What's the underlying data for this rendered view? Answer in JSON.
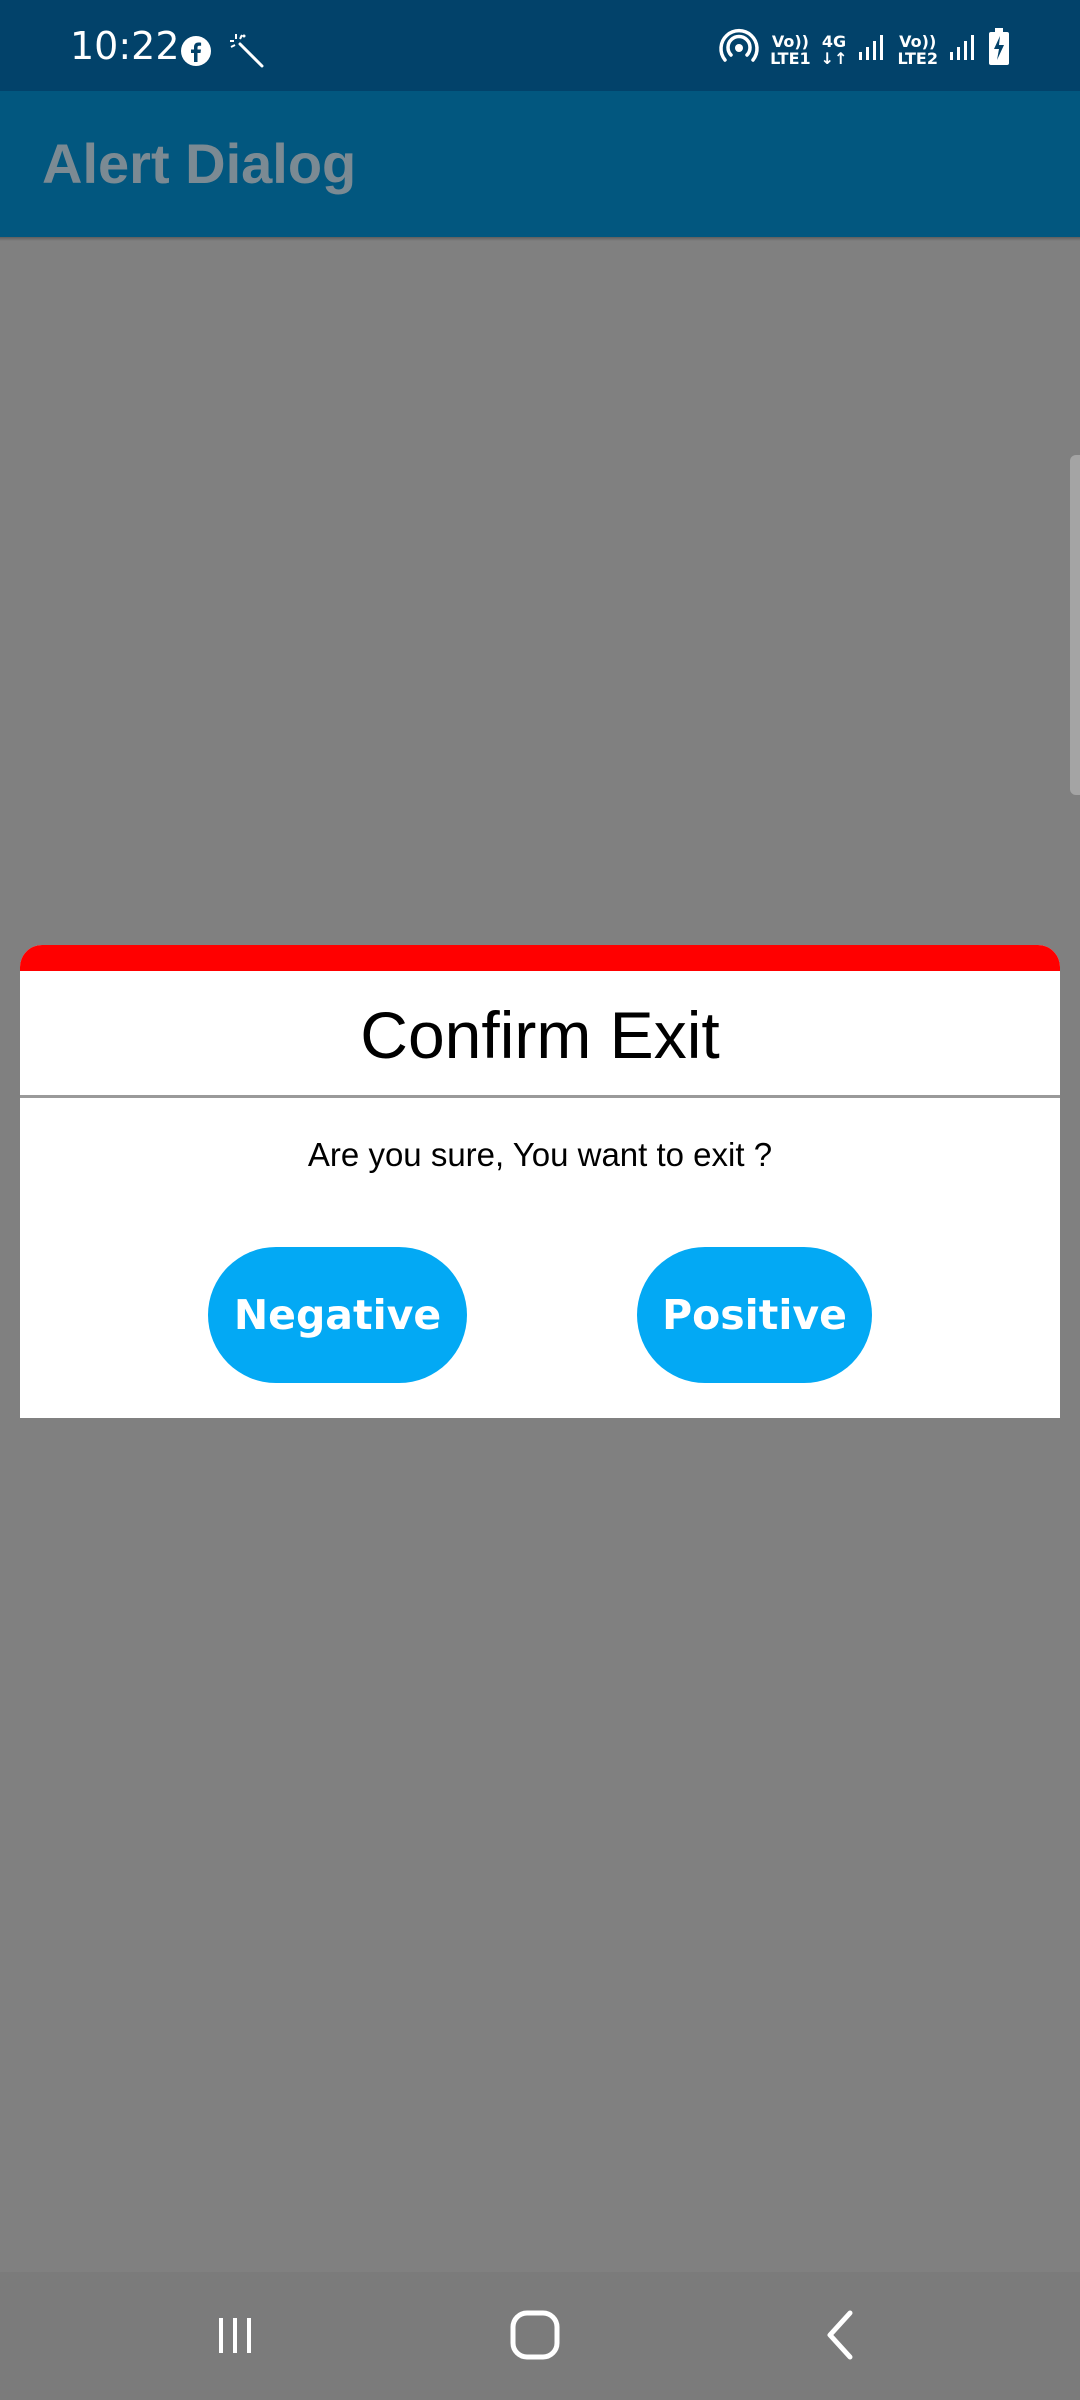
{
  "status_bar": {
    "time": "10:22",
    "left_icons": [
      "facebook-icon",
      "magic-wand-icon"
    ],
    "right_icons": [
      "hotspot-icon",
      "volte1-icon",
      "4g-data-icon",
      "signal1-icon",
      "volte2-icon",
      "signal2-icon",
      "battery-charging-icon"
    ],
    "volte1_top": "Vo))",
    "volte1_bottom": "LTE1",
    "net_type": "4G",
    "volte2_top": "Vo))",
    "volte2_bottom": "LTE2",
    "colors": {
      "background": "#02426a",
      "foreground": "#ffffff"
    }
  },
  "app_bar": {
    "title": "Alert Dialog",
    "colors": {
      "background": "#02577f",
      "title": "#7b8a93"
    }
  },
  "overlay_color": "#808080",
  "dialog": {
    "title": "Confirm Exit",
    "message": "Are you sure, You want to exit ?",
    "negative_label": "Negative",
    "positive_label": "Positive",
    "colors": {
      "accent_bar": "#ff0000",
      "button": "#03a9f4",
      "button_text": "#ffffff",
      "divider": "#9a9a9a"
    }
  },
  "nav_bar": {
    "items": [
      "recent-apps-icon",
      "home-icon",
      "back-icon"
    ]
  }
}
